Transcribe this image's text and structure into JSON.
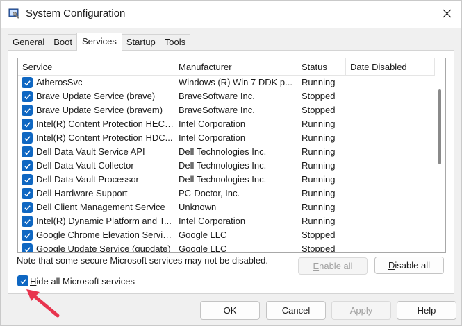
{
  "window": {
    "title": "System Configuration"
  },
  "tabs": [
    {
      "label": "General",
      "active": false
    },
    {
      "label": "Boot",
      "active": false
    },
    {
      "label": "Services",
      "active": true
    },
    {
      "label": "Startup",
      "active": false
    },
    {
      "label": "Tools",
      "active": false
    }
  ],
  "table": {
    "columns": [
      "Service",
      "Manufacturer",
      "Status",
      "Date Disabled"
    ],
    "rows": [
      {
        "service": "AtherosSvc",
        "manufacturer": "Windows (R) Win 7 DDK p...",
        "status": "Running",
        "date_disabled": "",
        "checked": true
      },
      {
        "service": "Brave Update Service (brave)",
        "manufacturer": "BraveSoftware Inc.",
        "status": "Stopped",
        "date_disabled": "",
        "checked": true
      },
      {
        "service": "Brave Update Service (bravem)",
        "manufacturer": "BraveSoftware Inc.",
        "status": "Stopped",
        "date_disabled": "",
        "checked": true
      },
      {
        "service": "Intel(R) Content Protection HECI...",
        "manufacturer": "Intel Corporation",
        "status": "Running",
        "date_disabled": "",
        "checked": true
      },
      {
        "service": "Intel(R) Content Protection HDC...",
        "manufacturer": "Intel Corporation",
        "status": "Running",
        "date_disabled": "",
        "checked": true
      },
      {
        "service": "Dell Data Vault Service API",
        "manufacturer": "Dell Technologies Inc.",
        "status": "Running",
        "date_disabled": "",
        "checked": true
      },
      {
        "service": "Dell Data Vault Collector",
        "manufacturer": "Dell Technologies Inc.",
        "status": "Running",
        "date_disabled": "",
        "checked": true
      },
      {
        "service": "Dell Data Vault Processor",
        "manufacturer": "Dell Technologies Inc.",
        "status": "Running",
        "date_disabled": "",
        "checked": true
      },
      {
        "service": "Dell Hardware Support",
        "manufacturer": "PC-Doctor, Inc.",
        "status": "Running",
        "date_disabled": "",
        "checked": true
      },
      {
        "service": "Dell Client Management Service",
        "manufacturer": "Unknown",
        "status": "Running",
        "date_disabled": "",
        "checked": true
      },
      {
        "service": "Intel(R) Dynamic Platform and T...",
        "manufacturer": "Intel Corporation",
        "status": "Running",
        "date_disabled": "",
        "checked": true
      },
      {
        "service": "Google Chrome Elevation Servic...",
        "manufacturer": "Google LLC",
        "status": "Stopped",
        "date_disabled": "",
        "checked": true
      },
      {
        "service": "Google Update Service (gupdate)",
        "manufacturer": "Google LLC",
        "status": "Stopped",
        "date_disabled": "",
        "checked": true
      }
    ]
  },
  "note": "Note that some secure Microsoft services may not be disabled.",
  "buttons": {
    "enable_all": {
      "prefix": "",
      "accel": "E",
      "rest": "nable all"
    },
    "disable_all": {
      "prefix": "",
      "accel": "D",
      "rest": "isable all"
    },
    "ok": "OK",
    "cancel": "Cancel",
    "apply": "Apply",
    "help": "Help"
  },
  "hide_ms": {
    "accel": "H",
    "rest": "ide all Microsoft services",
    "checked": true
  },
  "colors": {
    "checkbox": "#0f67c2",
    "arrow": "#e8344e"
  },
  "icons": {
    "app": "msconfig-icon",
    "close": "close-icon",
    "check": "checkmark-icon",
    "annotation": "red-arrow-icon"
  }
}
